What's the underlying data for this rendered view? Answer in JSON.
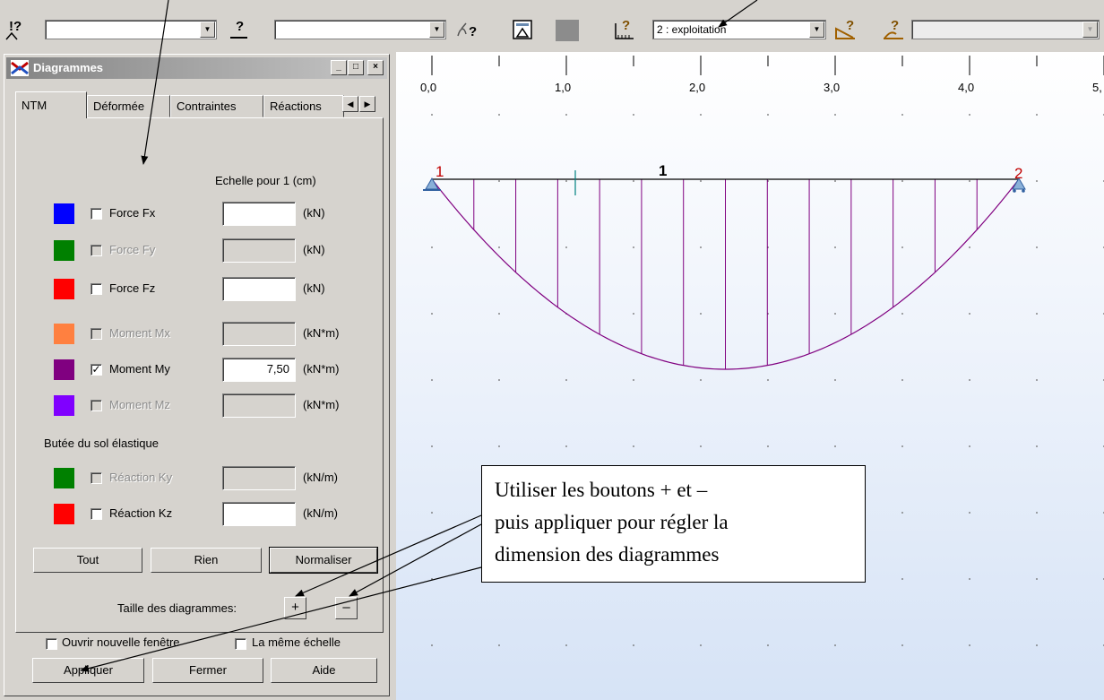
{
  "toolbar": {
    "combo1_value": "",
    "combo2_value": "",
    "load_case_value": "2 : exploitation",
    "combo3_value": ""
  },
  "dialog": {
    "title": "Diagrammes",
    "tabs": [
      {
        "label": "NTM"
      },
      {
        "label": "Déformée"
      },
      {
        "label": "Contraintes"
      },
      {
        "label": "Réactions"
      }
    ],
    "scale_header": "Echelle pour 1  (cm)",
    "rows": [
      {
        "color": "#0000ff",
        "checked": false,
        "enabled": true,
        "label": "Force Fx",
        "value": "",
        "unit": "(kN)"
      },
      {
        "color": "#008000",
        "checked": false,
        "enabled": false,
        "label": "Force Fy",
        "value": "",
        "unit": "(kN)"
      },
      {
        "color": "#ff0000",
        "checked": false,
        "enabled": true,
        "label": "Force Fz",
        "value": "",
        "unit": "(kN)"
      },
      {
        "color": "#ff8040",
        "checked": false,
        "enabled": false,
        "label": "Moment Mx",
        "value": "",
        "unit": "(kN*m)"
      },
      {
        "color": "#800080",
        "checked": true,
        "enabled": true,
        "label": "Moment My",
        "value": "7,50",
        "unit": "(kN*m)"
      },
      {
        "color": "#8000ff",
        "checked": false,
        "enabled": false,
        "label": "Moment Mz",
        "value": "",
        "unit": "(kN*m)"
      }
    ],
    "soil_section_label": "Butée du sol élastique",
    "soil_rows": [
      {
        "color": "#008000",
        "checked": false,
        "enabled": false,
        "label": "Réaction Ky",
        "value": "",
        "unit": "(kN/m)"
      },
      {
        "color": "#ff0000",
        "checked": false,
        "enabled": true,
        "label": "Réaction Kz",
        "value": "",
        "unit": "(kN/m)"
      }
    ],
    "buttons": {
      "all": "Tout",
      "none": "Rien",
      "normalize": "Normaliser"
    },
    "size_label": "Taille des diagrammes:",
    "plus": "+",
    "minus": "–",
    "new_window_label": "Ouvrir nouvelle fenêtre",
    "same_scale_label": "La même échelle",
    "apply": "Appliquer",
    "close": "Fermer",
    "help": "Aide",
    "window_buttons": {
      "minimize": "_",
      "maximize": "□",
      "close": "×"
    }
  },
  "canvas": {
    "ruler_labels": [
      "0,0",
      "1,0",
      "2,0",
      "3,0",
      "4,0",
      "5,"
    ],
    "node_labels": [
      "1",
      "2"
    ],
    "element_label": "1",
    "diagram_color": "#800080"
  },
  "callout": {
    "lines": [
      "Utiliser les boutons + et –",
      "puis appliquer pour régler la",
      "dimension des diagrammes"
    ]
  }
}
